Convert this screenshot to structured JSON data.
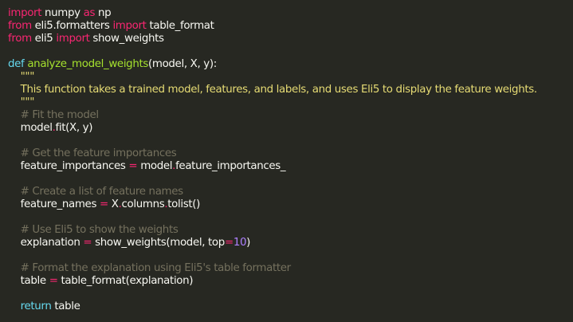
{
  "editor": {
    "lines": [
      [
        {
          "t": "import",
          "c": "kw"
        },
        {
          "t": " numpy ",
          "c": "tx"
        },
        {
          "t": "as",
          "c": "kw"
        },
        {
          "t": " np",
          "c": "tx"
        }
      ],
      [
        {
          "t": "from",
          "c": "kw"
        },
        {
          "t": " eli5.formatters ",
          "c": "tx"
        },
        {
          "t": "import",
          "c": "kw"
        },
        {
          "t": " table_format",
          "c": "tx"
        }
      ],
      [
        {
          "t": "from",
          "c": "kw"
        },
        {
          "t": " eli5 ",
          "c": "tx"
        },
        {
          "t": "import",
          "c": "kw"
        },
        {
          "t": " show_weights",
          "c": "tx"
        }
      ],
      [],
      [
        {
          "t": "def",
          "c": "def"
        },
        {
          "t": " ",
          "c": "tx"
        },
        {
          "t": "analyze_model_weights",
          "c": "fn"
        },
        {
          "t": "(model, X, y):",
          "c": "tx"
        }
      ],
      [
        {
          "t": "    \"\"\"",
          "c": "str"
        }
      ],
      [
        {
          "t": "    This function takes a trained model, features, and labels, and uses Eli5 to display the feature weights.",
          "c": "str"
        }
      ],
      [
        {
          "t": "    \"\"\"",
          "c": "str"
        }
      ],
      [
        {
          "t": "    # Fit the model",
          "c": "cm"
        }
      ],
      [
        {
          "t": "    model",
          "c": "tx"
        },
        {
          "t": ".",
          "c": "op"
        },
        {
          "t": "fit(X, y)",
          "c": "tx"
        }
      ],
      [],
      [
        {
          "t": "    # Get the feature importances",
          "c": "cm"
        }
      ],
      [
        {
          "t": "    feature_importances ",
          "c": "tx"
        },
        {
          "t": "=",
          "c": "op"
        },
        {
          "t": " model",
          "c": "tx"
        },
        {
          "t": ".",
          "c": "op"
        },
        {
          "t": "feature_importances_",
          "c": "tx"
        }
      ],
      [],
      [
        {
          "t": "    # Create a list of feature names",
          "c": "cm"
        }
      ],
      [
        {
          "t": "    feature_names ",
          "c": "tx"
        },
        {
          "t": "=",
          "c": "op"
        },
        {
          "t": " X",
          "c": "tx"
        },
        {
          "t": ".",
          "c": "op"
        },
        {
          "t": "columns",
          "c": "tx"
        },
        {
          "t": ".",
          "c": "op"
        },
        {
          "t": "tolist()",
          "c": "tx"
        }
      ],
      [],
      [
        {
          "t": "    # Use Eli5 to show the weights",
          "c": "cm"
        }
      ],
      [
        {
          "t": "    explanation ",
          "c": "tx"
        },
        {
          "t": "=",
          "c": "op"
        },
        {
          "t": " show_weights(model, top",
          "c": "tx"
        },
        {
          "t": "=",
          "c": "op"
        },
        {
          "t": "10",
          "c": "num"
        },
        {
          "t": ")",
          "c": "tx"
        }
      ],
      [],
      [
        {
          "t": "    # Format the explanation using Eli5's table formatter",
          "c": "cm"
        }
      ],
      [
        {
          "t": "    table ",
          "c": "tx"
        },
        {
          "t": "=",
          "c": "op"
        },
        {
          "t": " table_format(explanation)",
          "c": "tx"
        }
      ],
      [],
      [
        {
          "t": "    ",
          "c": "tx"
        },
        {
          "t": "return",
          "c": "def"
        },
        {
          "t": " table",
          "c": "tx"
        }
      ]
    ]
  }
}
